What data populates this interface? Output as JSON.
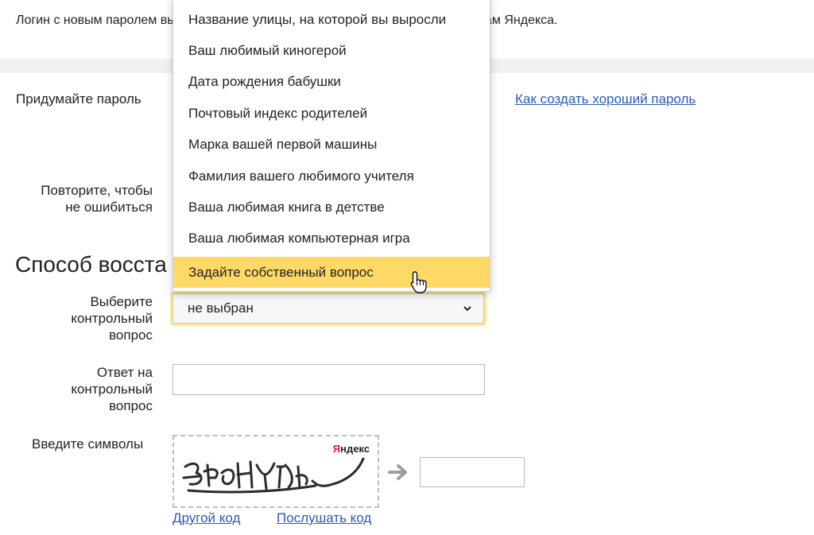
{
  "notice": {
    "text_start": "Логин с новым паролем вы",
    "text_end": "ам Яндекса."
  },
  "password": {
    "label": "Придумайте пароль",
    "help_link": "Как создать хороший пароль"
  },
  "repeat": {
    "label_line1": "Повторите, чтобы",
    "label_line2": "не ошибиться"
  },
  "recovery": {
    "section_title": "Способ восста",
    "question_label": [
      "Выберите",
      "контрольный",
      "вопрос"
    ],
    "selected_value": "не выбран",
    "answer_label": [
      "Ответ на",
      "контрольный",
      "вопрос"
    ]
  },
  "dropdown": {
    "options": [
      "Название улицы, на которой вы выросли",
      "Ваш любимый киногерой",
      "Дата рождения бабушки",
      "Почтовый индекс родителей",
      "Марка вашей первой машины",
      "Фамилия вашего любимого учителя",
      "Ваша любимая книга в детстве",
      "Ваша любимая компьютерная игра",
      "Задайте собственный вопрос"
    ],
    "highlighted_index": 8
  },
  "captcha": {
    "label": "Введите символы",
    "logo_first_letter": "Я",
    "logo_rest": "ндекс",
    "other_code_link": "Другой код",
    "listen_link": "Послушать код"
  },
  "colors": {
    "highlight": "#ffd966",
    "link": "#2a5bb8",
    "logo_red": "#e31b23"
  },
  "icons": {
    "select_caret": "chevron-down-icon",
    "cursor": "hand-pointer-icon",
    "arrow": "arrow-right-icon"
  }
}
